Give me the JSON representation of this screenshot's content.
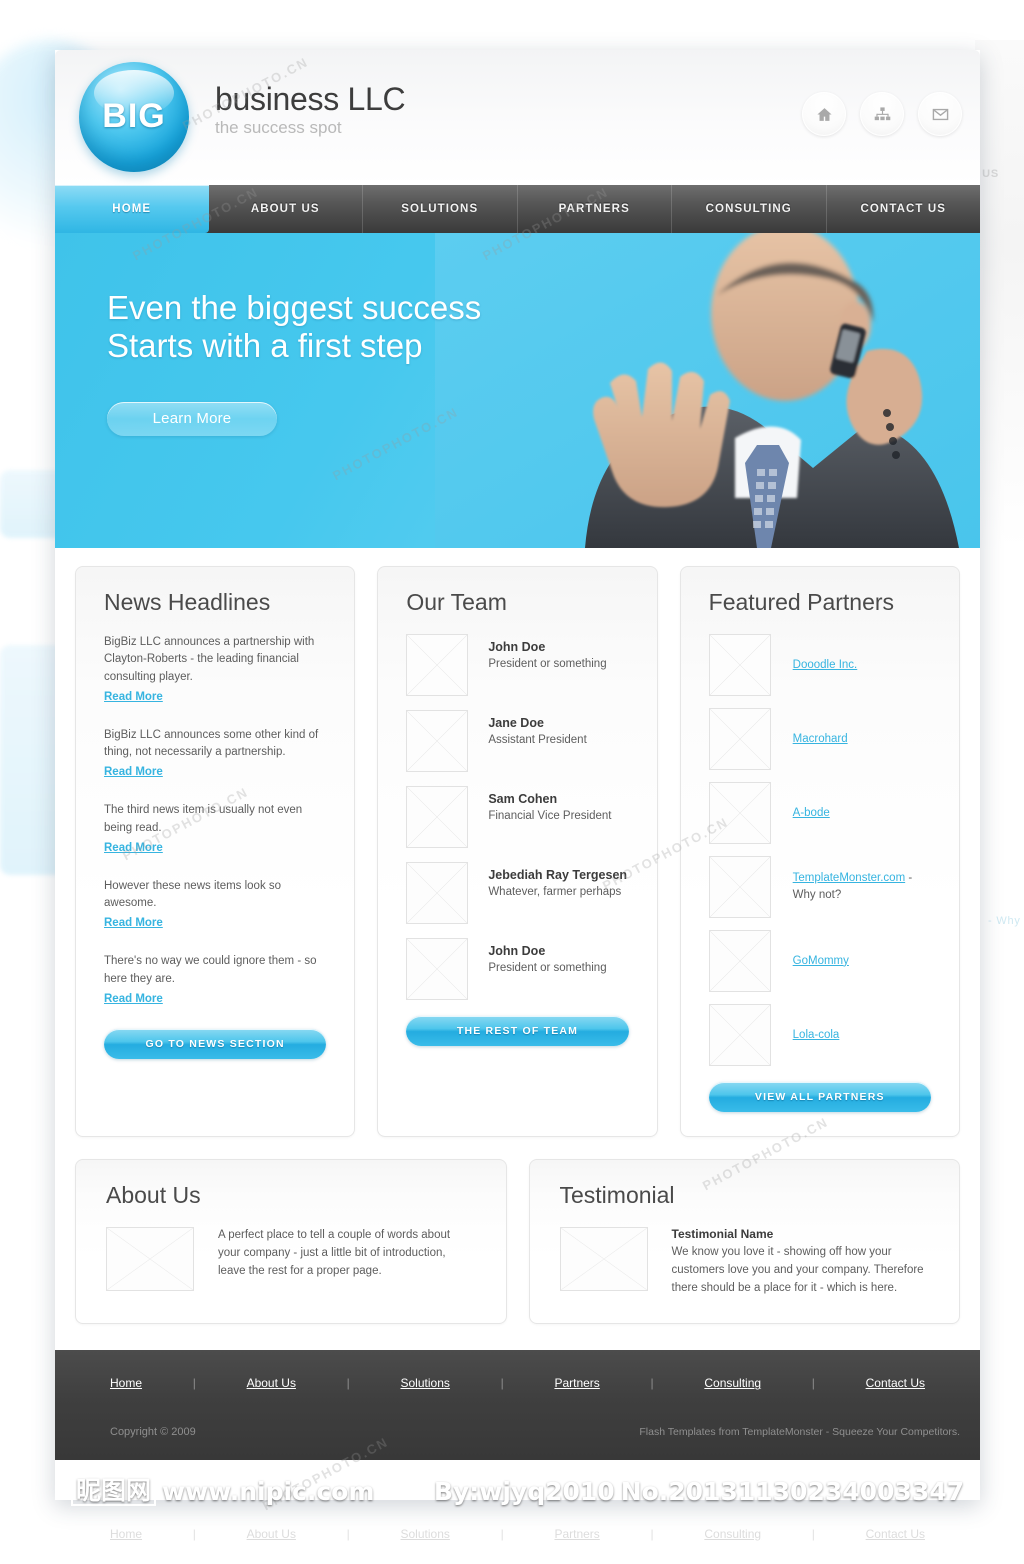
{
  "brand": {
    "logo_text": "BIG",
    "name": "business LLC",
    "tagline": "the success spot"
  },
  "header": {
    "icons": [
      {
        "name": "home-icon",
        "label": "Home"
      },
      {
        "name": "sitemap-icon",
        "label": "Sitemap"
      },
      {
        "name": "mail-icon",
        "label": "Contact"
      }
    ]
  },
  "nav": {
    "items": [
      {
        "label": "HOME",
        "active": true
      },
      {
        "label": "ABOUT US",
        "active": false
      },
      {
        "label": "SOLUTIONS",
        "active": false
      },
      {
        "label": "PARTNERS",
        "active": false
      },
      {
        "label": "CONSULTING",
        "active": false
      },
      {
        "label": "CONTACT US",
        "active": false
      }
    ]
  },
  "hero": {
    "line1": "Even the biggest success",
    "line2": "Starts with a first step",
    "cta_label": "Learn More",
    "photo_alt": "businessman-on-phone"
  },
  "news": {
    "title": "News Headlines",
    "read_more_label": "Read More",
    "items": [
      {
        "text": "BigBiz LLC announces a partnership with Clayton-Roberts - the leading financial consulting player."
      },
      {
        "text": "BigBiz LLC announces some other kind of thing, not necessarily a partnership."
      },
      {
        "text": "The third news item is usually not even being read."
      },
      {
        "text": "However these news items look so awesome."
      },
      {
        "text": "There's no way we could ignore them - so here they are."
      }
    ],
    "button_label": "GO TO NEWS SECTION"
  },
  "team": {
    "title": "Our Team",
    "members": [
      {
        "name": "John Doe",
        "role": "President or something"
      },
      {
        "name": "Jane Doe",
        "role": "Assistant President"
      },
      {
        "name": "Sam Cohen",
        "role": "Financial Vice President"
      },
      {
        "name": "Jebediah Ray Tergesen",
        "role": "Whatever, farmer perhaps"
      },
      {
        "name": "John Doe",
        "role": "President or something"
      }
    ],
    "button_label": "THE REST OF TEAM"
  },
  "partners": {
    "title": "Featured Partners",
    "items": [
      {
        "link": "Dooodle Inc.",
        "suffix": ""
      },
      {
        "link": "Macrohard",
        "suffix": ""
      },
      {
        "link": "A-bode",
        "suffix": ""
      },
      {
        "link": "TemplateMonster.com",
        "suffix": " - Why not?"
      },
      {
        "link": "GoMommy",
        "suffix": ""
      },
      {
        "link": "Lola-cola",
        "suffix": ""
      }
    ],
    "button_label": "VIEW ALL PARTNERS"
  },
  "about": {
    "title": "About Us",
    "text": "A perfect place to tell a couple of words about your company - just a little bit of introduction, leave the rest for a proper page."
  },
  "testimonial": {
    "title": "Testimonial",
    "name": "Testimonial Name",
    "text": "We know you love it - showing off how your customers love you and your company. Therefore there should be a place for it - which is here."
  },
  "footer": {
    "links": [
      "Home",
      "About Us",
      "Solutions",
      "Partners",
      "Consulting",
      "Contact Us"
    ],
    "separator": "|",
    "copyright": "Copyright © 2009",
    "credit": "Flash Templates from TemplateMonster - Squeeze Your Competitors."
  },
  "watermark": {
    "site_cn": "昵图网",
    "site_url": "www.nipic.com",
    "author": "By:wjyq2010",
    "number": "No.20131130234003347",
    "stock_text": "PHOTOPHOTO.CN"
  },
  "colors": {
    "accent": "#2fb6e4",
    "accent_light": "#8ad9f2",
    "link": "#36b4e0",
    "nav_dark": "#3a3a3a",
    "footer": "#3f3f3f",
    "body_text": "#5d5d5d",
    "heading": "#4a4a4a"
  }
}
